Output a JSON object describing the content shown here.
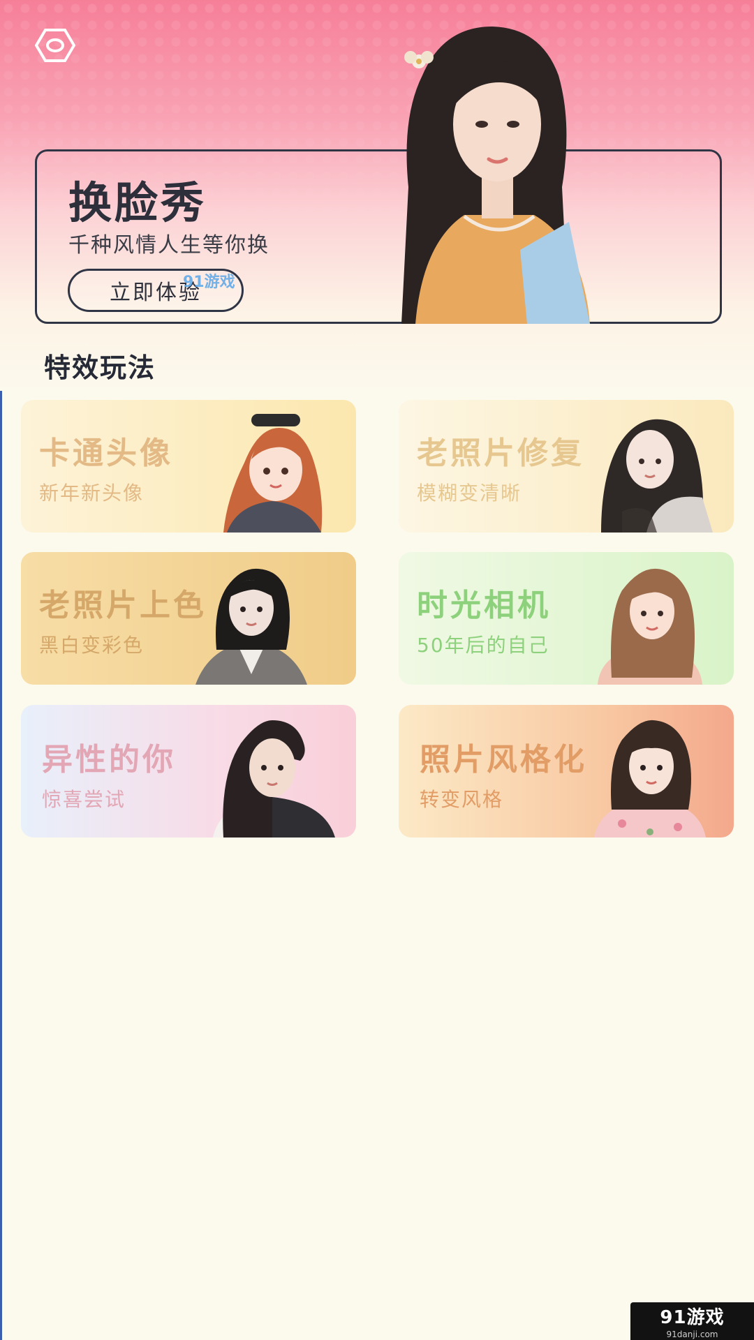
{
  "header": {
    "settings_icon": "hexagon-settings-icon"
  },
  "hero": {
    "title": "换脸秀",
    "subtitle": "千种风情人生等你换",
    "button_label": "立即体验",
    "watermark": "91游戏"
  },
  "section": {
    "title": "特效玩法"
  },
  "features": [
    {
      "title": "卡通头像",
      "subtitle": "新年新头像"
    },
    {
      "title": "老照片修复",
      "subtitle": "模糊变清晰"
    },
    {
      "title": "老照片上色",
      "subtitle": "黑白变彩色"
    },
    {
      "title": "时光相机",
      "subtitle": "50年后的自己"
    },
    {
      "title": "异性的你",
      "subtitle": "惊喜尝试"
    },
    {
      "title": "照片风格化",
      "subtitle": "转变风格"
    }
  ],
  "watermark_logo": {
    "main": "91游戏",
    "url": "91danji.com"
  },
  "colors": {
    "accent_pink": "#f67f98",
    "dark_text": "#2d2f3b",
    "page_bg": "#fcf9ed"
  }
}
